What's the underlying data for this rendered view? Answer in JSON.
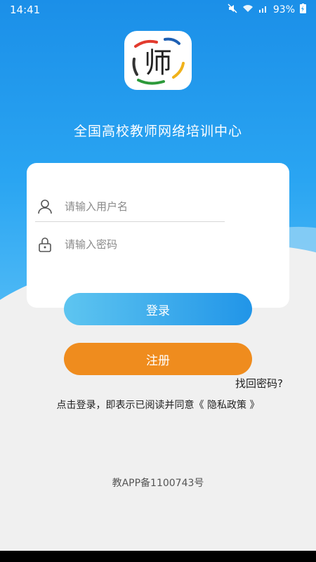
{
  "status": {
    "time": "14:41",
    "battery": "93%"
  },
  "app": {
    "title": "全国高校教师网络培训中心",
    "logo_text": "师"
  },
  "form": {
    "username_placeholder": "请输入用户名",
    "password_placeholder": "请输入密码"
  },
  "buttons": {
    "login": "登录",
    "register": "注册"
  },
  "links": {
    "forgot": "找回密码?"
  },
  "agreement": {
    "prefix": "点击登录，即表示已阅读并同意",
    "policy": "《 隐私政策 》"
  },
  "footer": {
    "record": "教APP备1100743号"
  },
  "colors": {
    "primary": "#2195e8",
    "accent": "#ef8c1e"
  }
}
